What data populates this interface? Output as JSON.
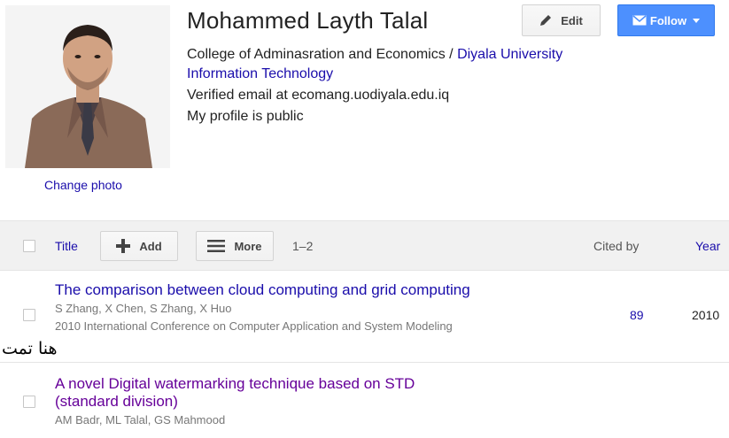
{
  "profile": {
    "name": "Mohammed Layth Talal",
    "affiliation_prefix": "College of Adminasration and Economics / ",
    "affiliation_link": "Diyala University",
    "interest": "Information Technology",
    "email": "Verified email at ecomang.uodiyala.edu.iq",
    "visibility": "My profile is public",
    "change_photo": "Change photo",
    "photo_icon": "profile-photo"
  },
  "actions": {
    "edit_label": "Edit",
    "follow_label": "Follow",
    "edit_icon": "pencil-icon",
    "follow_icon": "mail-icon"
  },
  "toolbar": {
    "title_label": "Title",
    "add_label": "Add",
    "more_label": "More",
    "range": "1–2",
    "cited_by_label": "Cited by",
    "year_label": "Year"
  },
  "articles": [
    {
      "title": "The comparison between cloud computing and grid computing",
      "authors": "S Zhang, X Chen, S Zhang, X Huo",
      "venue": "2010 International Conference on Computer Application and System Modeling",
      "cited_by": "89",
      "year": "2010"
    },
    {
      "title": "A novel Digital watermarking technique based on STD (standard division)",
      "authors": "AM Badr, ML Talal, GS Mahmood",
      "venue": "",
      "cited_by": "",
      "year": ""
    }
  ],
  "annotation": "هنا تمت",
  "colors": {
    "link": "#1a0dab",
    "visited": "#660099",
    "follow_button": "#4d90fe",
    "toolbar_bg": "#f1f1f1"
  }
}
